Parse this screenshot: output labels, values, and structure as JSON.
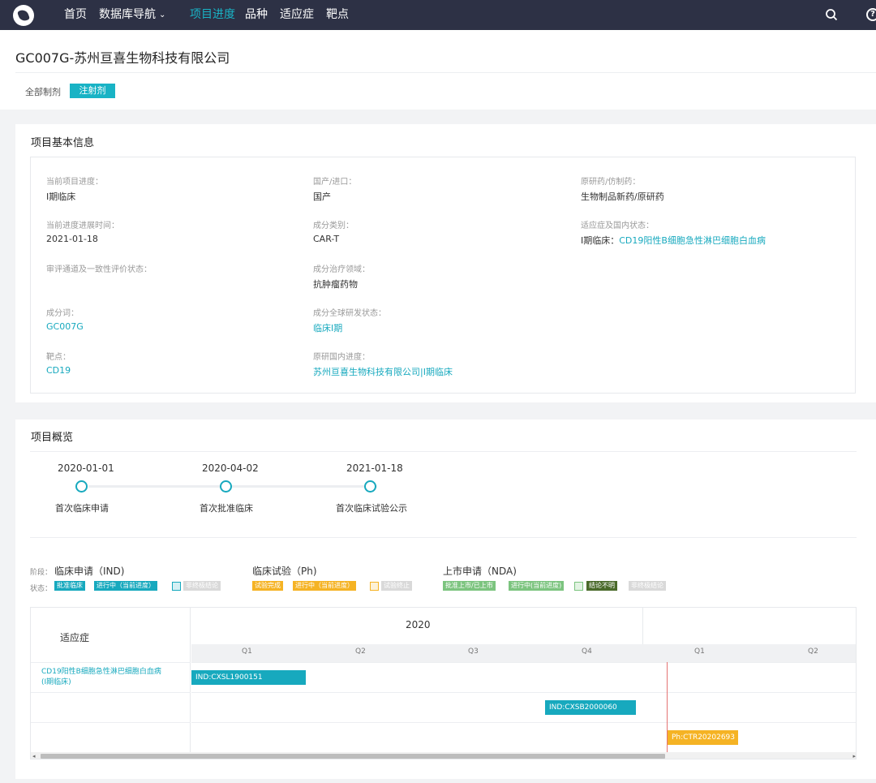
{
  "nav": {
    "home": "首页",
    "db_nav": "数据库导航",
    "progress": "项目进度",
    "variety": "品种",
    "indication": "适应症",
    "target": "靶点"
  },
  "page": {
    "title": "GC007G-苏州亘喜生物科技有限公司",
    "filter_all": "全部制剂",
    "filter_injection": "注射剂"
  },
  "basic_info": {
    "title": "项目基本信息",
    "fields": [
      {
        "label": "当前项目进度：",
        "value": "I期临床"
      },
      {
        "label": "国产/进口：",
        "value": "国产"
      },
      {
        "label": "原研药/仿制药：",
        "value": "生物制品新药/原研药"
      },
      {
        "label": "当前进度进展时间：",
        "value": "2021-01-18"
      },
      {
        "label": "成分类别：",
        "value": "CAR-T"
      },
      {
        "label": "适应症及国内状态：",
        "value_prefix": "I期临床：",
        "value": "CD19阳性B细胞急性淋巴细胞白血病"
      },
      {
        "label": "审评通道及一致性评价状态：",
        "value": ""
      },
      {
        "label": "成分治疗领域：",
        "value": "抗肿瘤药物"
      },
      {
        "label": "成分词：",
        "value": "GC007G"
      },
      {
        "label": "成分全球研发状态：",
        "value": "临床I期"
      },
      {
        "label": "靶点：",
        "value": "CD19"
      },
      {
        "label": "原研国内进度：",
        "value": "苏州亘喜生物科技有限公司|I期临床"
      }
    ]
  },
  "overview": {
    "title": "项目概览",
    "milestones": [
      {
        "date": "2020-01-01",
        "label": "首次临床申请"
      },
      {
        "date": "2020-04-02",
        "label": "首次批准临床"
      },
      {
        "date": "2021-01-18",
        "label": "首次临床试验公示"
      }
    ],
    "legend": {
      "stage_label": "阶段：",
      "status_label": "状态：",
      "phases": [
        {
          "name": "临床申请（IND)",
          "badges": [
            {
              "text": "批准临床",
              "color": "#17a9be"
            },
            {
              "text": "进行中（当前进度）",
              "color": "#17a9be"
            },
            {
              "text": "非终极结论",
              "color": "#d9d9d9"
            }
          ]
        },
        {
          "name": "临床试验（Ph)",
          "badges": [
            {
              "text": "试验完成",
              "color": "#f5b324"
            },
            {
              "text": "进行中（当前进度）",
              "color": "#f5b324"
            },
            {
              "text": "试验终止",
              "color": "#d9d9d9"
            }
          ]
        },
        {
          "name": "上市申请（NDA)",
          "badges": [
            {
              "text": "批准上市/已上市",
              "color": "#7cc47f"
            },
            {
              "text": "进行中(当前进度)",
              "color": "#7cc47f"
            },
            {
              "text": "结论不明",
              "color": "#4a6a2a"
            },
            {
              "text": "非终极结论",
              "color": "#d9d9d9"
            }
          ]
        }
      ]
    },
    "gantt": {
      "indication_header": "适应症",
      "year": "2020",
      "quarters": [
        "Q1",
        "Q2",
        "Q3",
        "Q4",
        "Q1",
        "Q2"
      ],
      "rows": [
        {
          "indication": "CD19阳性B细胞急性淋巴细胞白血病(I期临床)",
          "bar": "IND:CXSL1900151"
        },
        {
          "indication": "",
          "bar": "IND:CXSB2000060"
        },
        {
          "indication": "",
          "bar": "Ph:CTR20202693"
        }
      ],
      "colors": {
        "ind": "#17a9be",
        "ph": "#f5b324",
        "today": "#e57373"
      }
    }
  }
}
